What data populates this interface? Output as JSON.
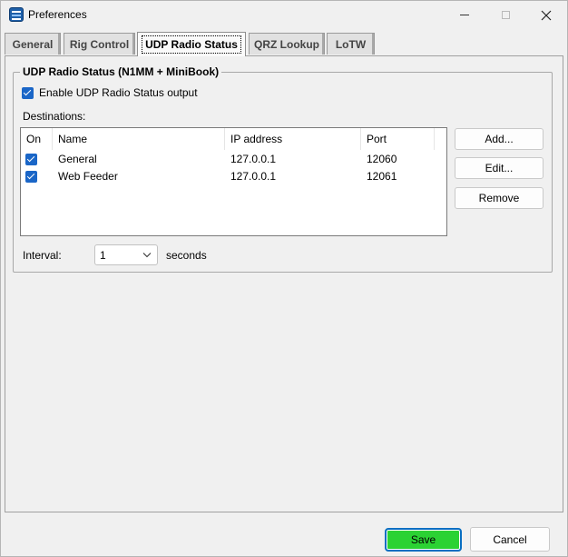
{
  "window": {
    "title": "Preferences"
  },
  "tabs": [
    {
      "label": "General"
    },
    {
      "label": "Rig Control"
    },
    {
      "label": "UDP Radio Status"
    },
    {
      "label": "QRZ Lookup"
    },
    {
      "label": "LoTW"
    }
  ],
  "active_tab": "UDP Radio Status",
  "udp": {
    "group_title": "UDP Radio Status (N1MM + MiniBook)",
    "enable_label": "Enable UDP Radio Status output",
    "enable_checked": true,
    "destinations_label": "Destinations:",
    "columns": {
      "on": "On",
      "name": "Name",
      "ip": "IP address",
      "port": "Port"
    },
    "rows": [
      {
        "on": true,
        "name": "General",
        "ip": "127.0.0.1",
        "port": "12060"
      },
      {
        "on": true,
        "name": "Web Feeder",
        "ip": "127.0.0.1",
        "port": "12061"
      }
    ],
    "buttons": {
      "add": "Add...",
      "edit": "Edit...",
      "remove": "Remove"
    },
    "interval_label": "Interval:",
    "interval_value": "1",
    "seconds_label": "seconds"
  },
  "footer": {
    "save": "Save",
    "cancel": "Cancel"
  },
  "colors": {
    "accent": "#1a66c7",
    "save_button": "#2bd233",
    "focus_border": "#0a6fc2"
  }
}
